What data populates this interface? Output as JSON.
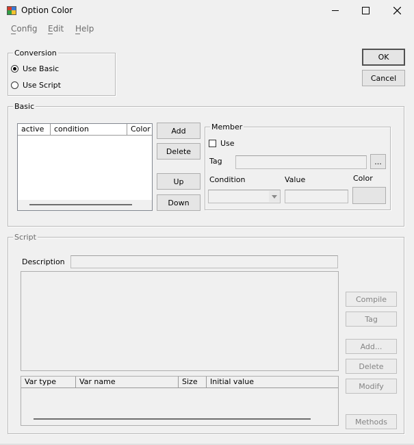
{
  "window": {
    "title": "Option Color",
    "minimize_glyph": "—",
    "maximize_glyph": "☐",
    "close_glyph": "✕"
  },
  "menu": [
    {
      "label": "Config"
    },
    {
      "label": "Edit"
    },
    {
      "label": "Help"
    }
  ],
  "conversion": {
    "label": "Conversion",
    "use_basic": "Use Basic",
    "use_script": "Use Script",
    "selected": "Use Basic"
  },
  "buttons": {
    "ok": "OK",
    "cancel": "Cancel"
  },
  "basic": {
    "label": "Basic",
    "columns": [
      "active",
      "condition",
      "Color"
    ],
    "add": "Add",
    "delete": "Delete",
    "up": "Up",
    "down": "Down",
    "member": {
      "label": "Member",
      "use": "Use",
      "tag": "Tag",
      "tag_browse": "...",
      "condition": "Condition",
      "value": "Value",
      "color": "Color"
    }
  },
  "script": {
    "label": "Script",
    "description": "Description",
    "compile": "Compile",
    "tag": "Tag",
    "add": "Add...",
    "delete": "Delete",
    "modify": "Modify",
    "methods": "Methods",
    "var_columns": [
      "Var type",
      "Var name",
      "Size",
      "Initial value"
    ]
  },
  "colors": {
    "background": "#f0f0f0",
    "group_border": "#b9b9b9",
    "disabled_text": "#838383"
  }
}
